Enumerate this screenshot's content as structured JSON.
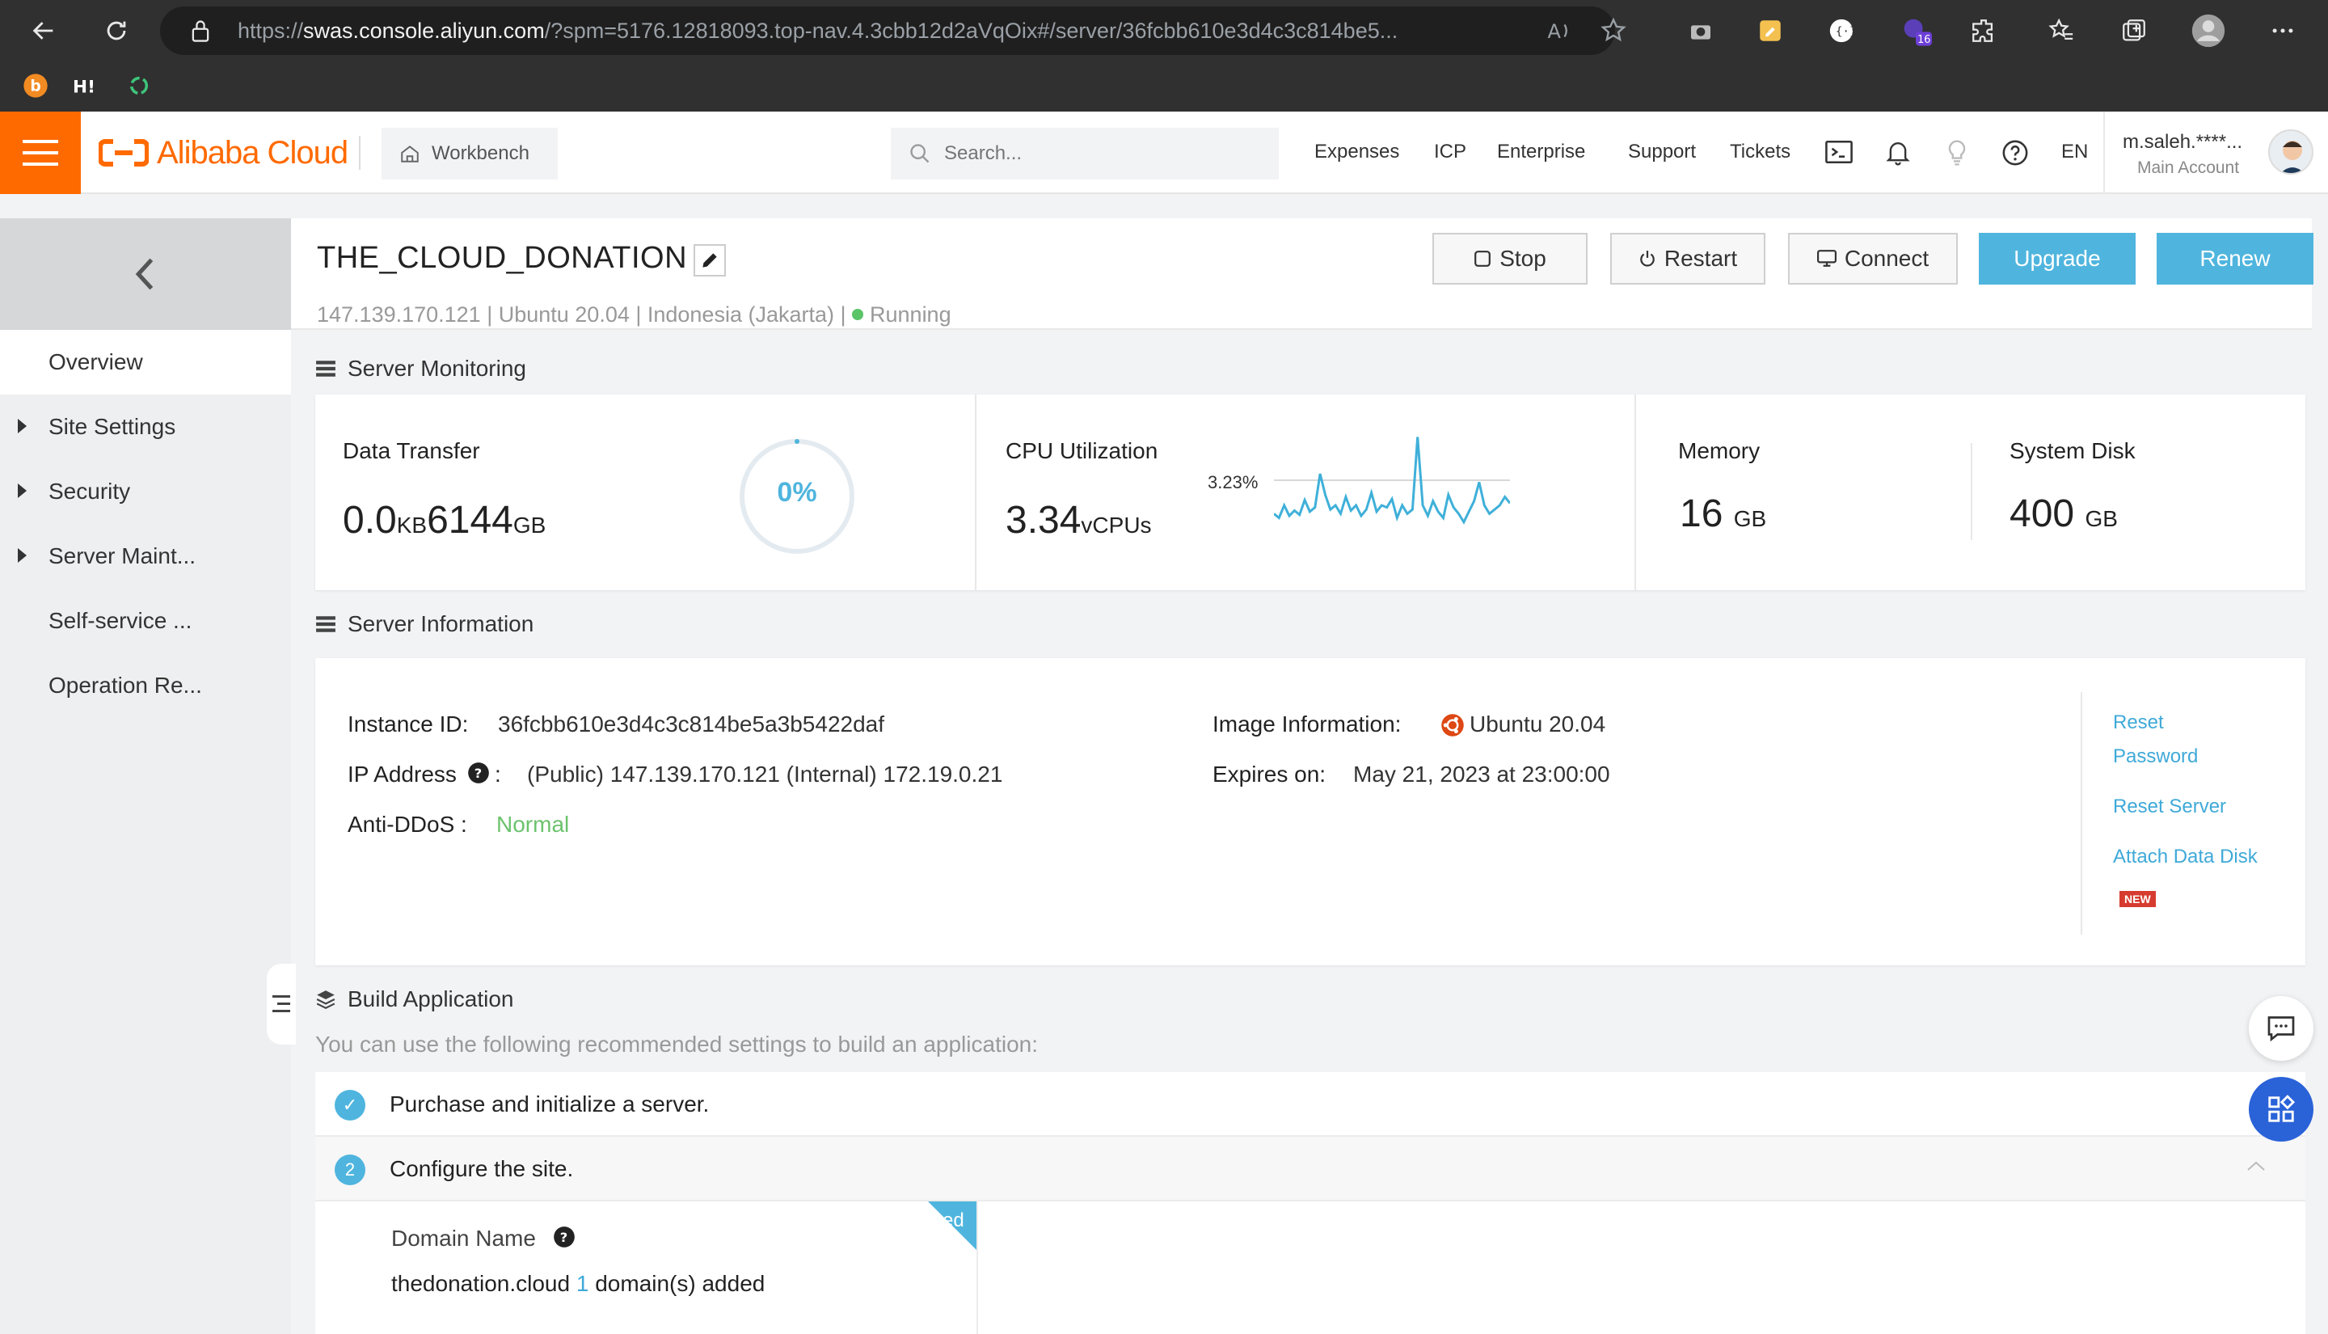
{
  "browser": {
    "url_prefix": "https://",
    "url_host": "swas.console.aliyun.com",
    "url_rest": "/?spm=5176.12818093.top-nav.4.3cbb12d2aVqOix#/server/36fcbb610e3d4c3c814be5...",
    "ext_badge": "16"
  },
  "topnav": {
    "logo_text": "Alibaba Cloud",
    "workbench": "Workbench",
    "search_placeholder": "Search...",
    "links": [
      "Expenses",
      "ICP",
      "Enterprise",
      "Support",
      "Tickets"
    ],
    "lang": "EN",
    "user_name": "m.saleh.****...",
    "user_role": "Main Account"
  },
  "sidebar": {
    "items": [
      {
        "label": "Overview",
        "active": true,
        "expandable": false
      },
      {
        "label": "Site Settings",
        "active": false,
        "expandable": true
      },
      {
        "label": "Security",
        "active": false,
        "expandable": true
      },
      {
        "label": "Server Maint...",
        "active": false,
        "expandable": true
      },
      {
        "label": "Self-service ...",
        "active": false,
        "expandable": false
      },
      {
        "label": "Operation Re...",
        "active": false,
        "expandable": false
      }
    ]
  },
  "server": {
    "name": "THE_CLOUD_DONATION",
    "meta": "147.139.170.121 | Ubuntu 20.04 | Indonesia (Jakarta) | ",
    "status": "Running",
    "buttons": {
      "stop": "Stop",
      "restart": "Restart",
      "connect": "Connect",
      "upgrade": "Upgrade",
      "renew": "Renew"
    }
  },
  "monitoring": {
    "title": "Server Monitoring",
    "data_transfer": {
      "label": "Data Transfer",
      "used": "0.0",
      "used_unit": "KB",
      "total": "6144",
      "total_unit": "GB",
      "percent_text": "0%"
    },
    "cpu": {
      "label": "CPU Utilization",
      "value": "3.34",
      "unit": "vCPUs",
      "peak_label": "3.23%"
    },
    "memory": {
      "label": "Memory",
      "value": "16",
      "unit": "GB"
    },
    "disk": {
      "label": "System Disk",
      "value": "400",
      "unit": "GB"
    }
  },
  "info": {
    "title": "Server Information",
    "instance_id_label": "Instance ID:",
    "instance_id": "36fcbb610e3d4c3c814be5a3b5422daf",
    "ip_label": "IP Address",
    "ip_colon": ":",
    "ip_value": "(Public) 147.139.170.121 (Internal) 172.19.0.21",
    "ddos_label": "Anti-DDoS :",
    "ddos_value": "Normal",
    "image_label": "Image Information:",
    "image_value": "Ubuntu 20.04",
    "expires_label": "Expires on:",
    "expires_value": "May 21, 2023 at 23:00:00",
    "actions": {
      "reset_password_1": "Reset",
      "reset_password_2": "Password",
      "reset_server": "Reset Server",
      "attach_disk": "Attach Data Disk",
      "new_badge": "NEW"
    }
  },
  "build": {
    "title": "Build Application",
    "subtitle": "You can use the following recommended settings to build an application:",
    "steps": [
      {
        "num": "✓",
        "text": "Purchase and initialize a server."
      },
      {
        "num": "2",
        "text": "Configure the site."
      }
    ],
    "domain_label": "Domain Name",
    "domain_value": "thedonation.cloud",
    "domain_count": "1",
    "domain_suffix": "domain(s) added",
    "ribbon": "ed"
  },
  "cpu_series": [
    22,
    18,
    30,
    20,
    25,
    21,
    35,
    24,
    28,
    60,
    40,
    26,
    30,
    22,
    38,
    25,
    30,
    20,
    26,
    42,
    24,
    30,
    28,
    36,
    18,
    30,
    22,
    26,
    95,
    30,
    20,
    34,
    24,
    18,
    40,
    28,
    22,
    14,
    24,
    34,
    52,
    30,
    22,
    26,
    30,
    38,
    32
  ]
}
